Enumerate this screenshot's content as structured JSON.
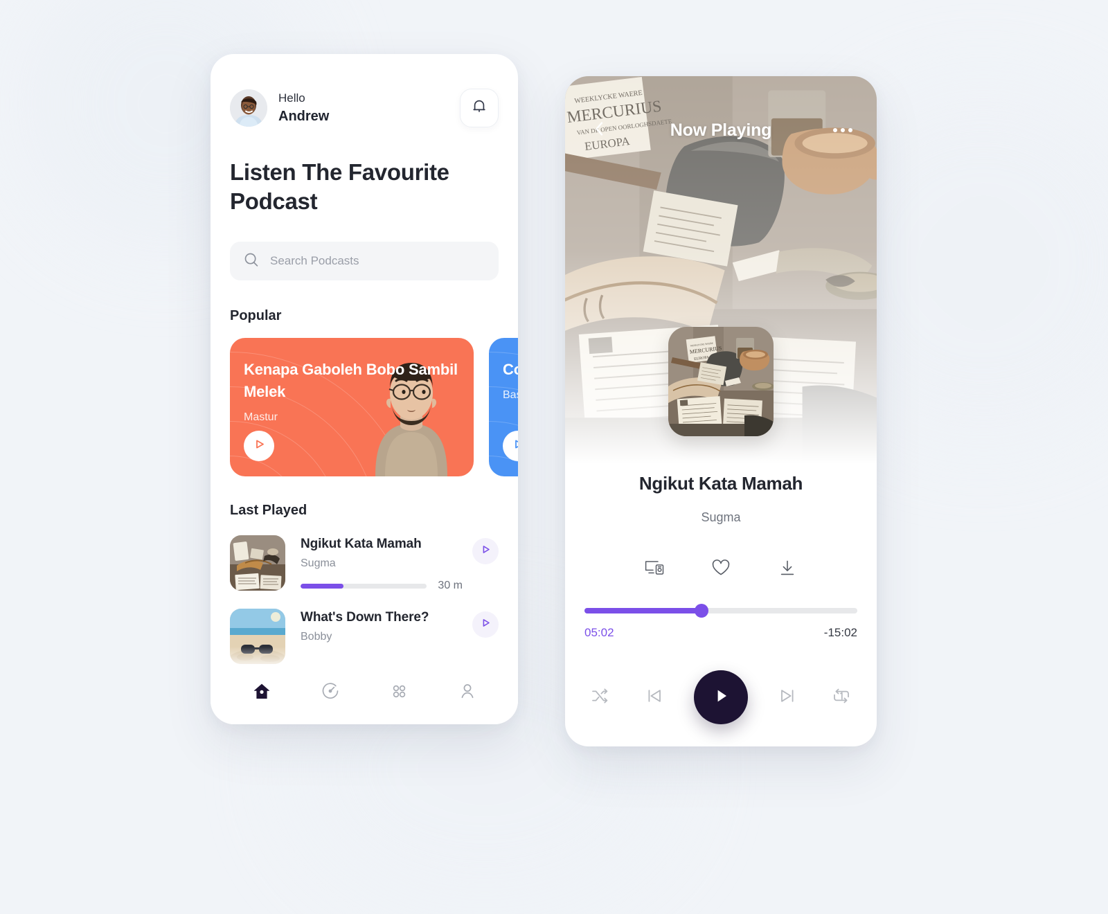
{
  "theme": {
    "background": "#f1f4f8",
    "accent_purple": "#7b4fe8",
    "card_orange": "#f97455",
    "card_blue": "#4a93f5",
    "dark": "#1d1333"
  },
  "home": {
    "greeting": "Hello",
    "user_name": "Andrew",
    "avatar_icon": "user-avatar-photo",
    "notification_icon": "bell-icon",
    "headline": "Listen The Favourite Podcast",
    "search": {
      "icon": "search-icon",
      "placeholder": "Search Podcasts",
      "value": ""
    },
    "popular": {
      "heading": "Popular",
      "cards": [
        {
          "title": "Kenapa Gaboleh Bobo Sambil Melek",
          "author": "Mastur",
          "color": "#f97455",
          "play_icon": "play-icon"
        },
        {
          "title": "Cowok Sisa",
          "author": "Bas",
          "color": "#4a93f5",
          "play_icon": "play-icon"
        }
      ]
    },
    "last_played": {
      "heading": "Last Played",
      "tracks": [
        {
          "title": "Ngikut Kata Mamah",
          "artist": "Sugma",
          "duration": "30 m",
          "progress": 34,
          "artwork": "still-life-painting",
          "play_icon": "play-icon"
        },
        {
          "title": "What's Down There?",
          "artist": "Bobby",
          "duration": "",
          "progress": 0,
          "artwork": "beach-sunglasses",
          "play_icon": "play-icon"
        }
      ]
    },
    "nav": [
      {
        "name": "home",
        "icon": "home-icon",
        "active": true
      },
      {
        "name": "discover",
        "icon": "disc-clock-icon",
        "active": false
      },
      {
        "name": "categories",
        "icon": "grid-dots-icon",
        "active": false
      },
      {
        "name": "profile",
        "icon": "person-icon",
        "active": false
      }
    ]
  },
  "player": {
    "back_icon": "chevron-left-icon",
    "title": "Now Playing",
    "more_icon": "ellipsis-icon",
    "cover_art": "still-life-painting",
    "track_title": "Ngikut Kata Mamah",
    "track_artist": "Sugma",
    "actions": [
      {
        "name": "cast",
        "icon": "cast-device-icon"
      },
      {
        "name": "favourite",
        "icon": "heart-icon"
      },
      {
        "name": "download",
        "icon": "download-icon"
      }
    ],
    "seek": {
      "current_time": "05:02",
      "remaining_time": "-15:02",
      "progress": 43
    },
    "controls": [
      {
        "name": "shuffle",
        "icon": "shuffle-icon"
      },
      {
        "name": "previous",
        "icon": "skip-back-icon"
      },
      {
        "name": "play",
        "icon": "play-icon"
      },
      {
        "name": "next",
        "icon": "skip-forward-icon"
      },
      {
        "name": "repeat-one",
        "icon": "repeat-one-icon"
      }
    ]
  }
}
